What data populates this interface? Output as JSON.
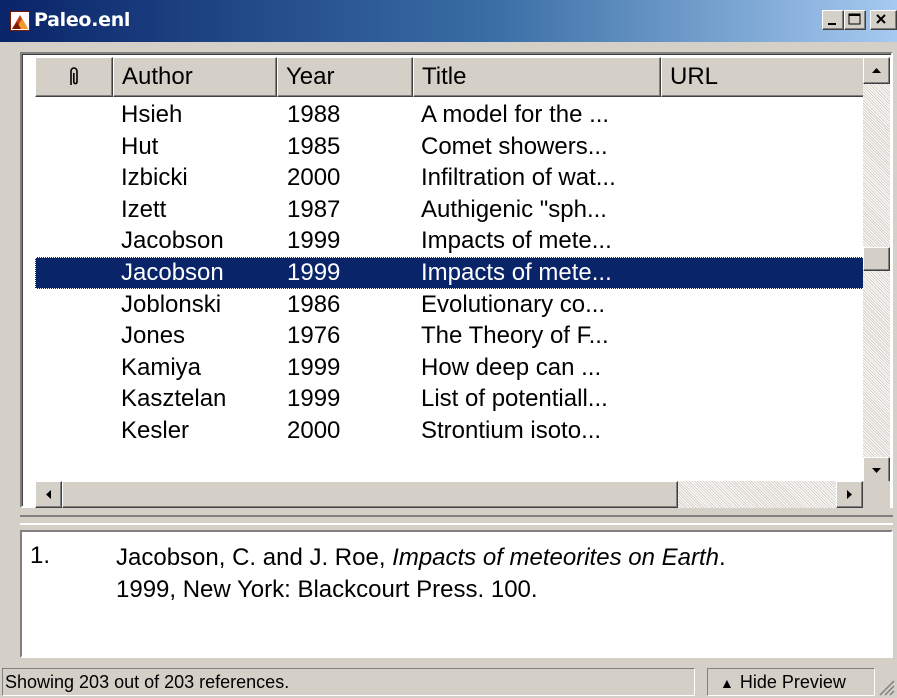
{
  "window": {
    "title": "Paleo.enl"
  },
  "columns": [
    {
      "label": "",
      "icon": "paperclip-icon"
    },
    {
      "label": "Author"
    },
    {
      "label": "Year"
    },
    {
      "label": "Title"
    },
    {
      "label": "URL"
    }
  ],
  "rows": [
    {
      "author": "Hsieh",
      "year": "1988",
      "title": "A model for the ..."
    },
    {
      "author": "Hut",
      "year": "1985",
      "title": "Comet showers..."
    },
    {
      "author": "Izbicki",
      "year": "2000",
      "title": "Infiltration of wat..."
    },
    {
      "author": "Izett",
      "year": "1987",
      "title": "Authigenic \"sph..."
    },
    {
      "author": "Jacobson",
      "year": "1999",
      "title": "Impacts of mete..."
    },
    {
      "author": "Jacobson",
      "year": "1999",
      "title": "Impacts of mete...",
      "selected": true
    },
    {
      "author": "Joblonski",
      "year": "1986",
      "title": "Evolutionary co..."
    },
    {
      "author": "Jones",
      "year": "1976",
      "title": "The Theory of F..."
    },
    {
      "author": "Kamiya",
      "year": "1999",
      "title": "How deep can ..."
    },
    {
      "author": "Kasztelan",
      "year": "1999",
      "title": "List of potentiall..."
    },
    {
      "author": "Kesler",
      "year": "2000",
      "title": "Strontium isoto..."
    }
  ],
  "preview": {
    "number": "1.",
    "authors": "Jacobson, C. and J. Roe, ",
    "title": "Impacts of meteorites on Earth",
    "rest_line1": ".",
    "rest_line2": "1999, New York: Blackcourt Press. 100."
  },
  "status": {
    "text": "Showing 203 out of 203 references.",
    "hide_preview_label": "Hide Preview"
  },
  "colors": {
    "selection": "#0a246a",
    "titlebar_start": "#0a246a",
    "titlebar_end": "#a6caf0"
  }
}
